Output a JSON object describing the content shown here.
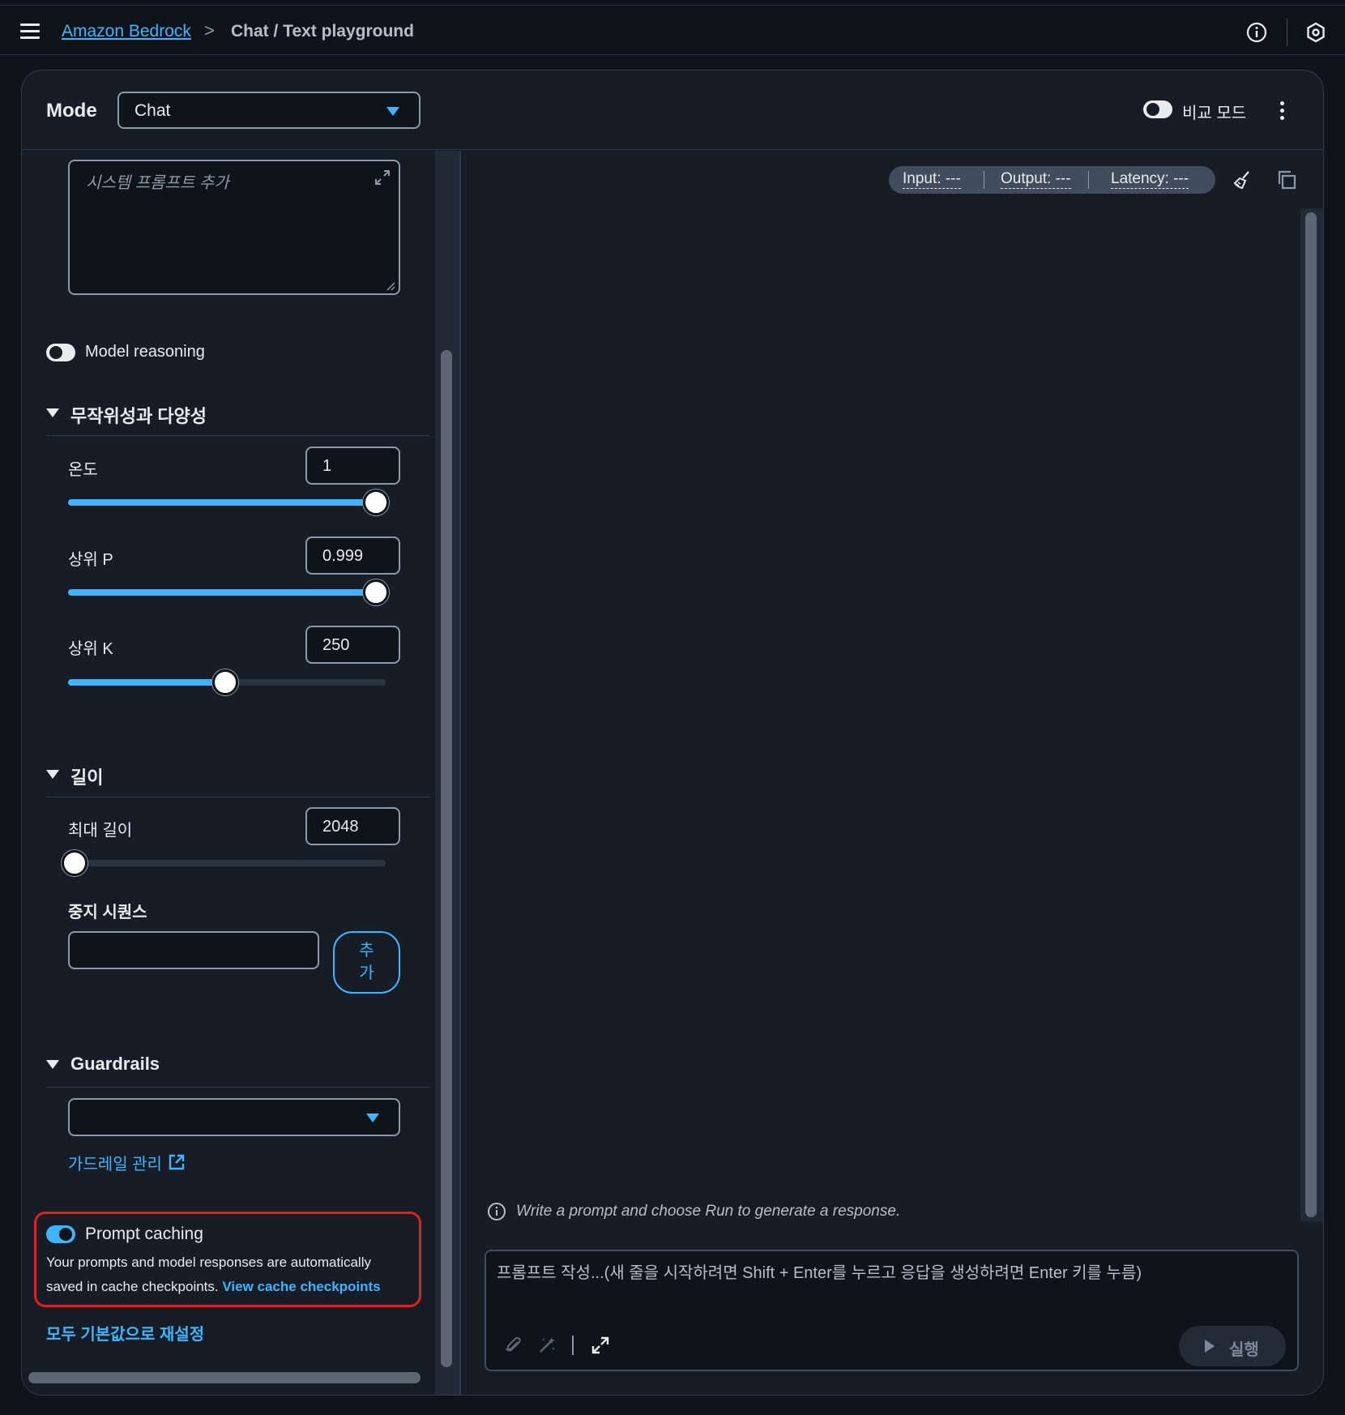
{
  "header": {
    "breadcrumb_link": "Amazon Bedrock",
    "breadcrumb_separator": ">",
    "breadcrumb_current": "Chat / Text playground",
    "icons": [
      "menu-icon",
      "info-icon",
      "settings-icon"
    ]
  },
  "mode": {
    "label": "Mode",
    "selected": "Chat",
    "compare_mode_label": "비교 모드",
    "compare_mode_enabled": false
  },
  "left_panel": {
    "system_prompt_placeholder": "시스템 프롬프트 추가",
    "model_reasoning_label": "Model reasoning",
    "model_reasoning_enabled": false,
    "randomness_section_title": "무작위성과 다양성",
    "temperature": {
      "label": "온도",
      "value": "1",
      "fill_fraction": 1.0
    },
    "top_p": {
      "label": "상위 P",
      "value": "0.999",
      "fill_fraction": 1.0
    },
    "top_k": {
      "label": "상위 K",
      "value": "250",
      "fill_fraction": 0.5
    },
    "length_section_title": "길이",
    "max_length": {
      "label": "최대 길이",
      "value": "2048",
      "fill_fraction": 0.0
    },
    "stop_sequences_label": "중지 시퀀스",
    "stop_sequences_value": "",
    "add_button_label": "추가",
    "guardrails_section_title": "Guardrails",
    "guardrails_selected": "",
    "manage_guardrails_link": "가드레일 관리",
    "prompt_caching": {
      "title": "Prompt caching",
      "enabled": true,
      "description": "Your prompts and model responses are automatically saved in cache checkpoints.",
      "link_label": "View cache checkpoints"
    },
    "reset_link": "모두 기본값으로 재설정"
  },
  "right_panel": {
    "metrics": {
      "input": "Input: ---",
      "output": "Output: ---",
      "latency": "Latency: ---"
    },
    "hint_text": "Write a prompt and choose Run to generate a response.",
    "prompt_placeholder": "프롬프트 작성...(새 줄을 시작하려면 Shift + Enter를 누르고 응답을 생성하려면 Enter 키를 누름)",
    "run_button_label": "실행"
  },
  "colors": {
    "accent": "#42b4ff",
    "background": "#0f141a",
    "card": "#161d26",
    "highlight_border": "#e02020"
  }
}
